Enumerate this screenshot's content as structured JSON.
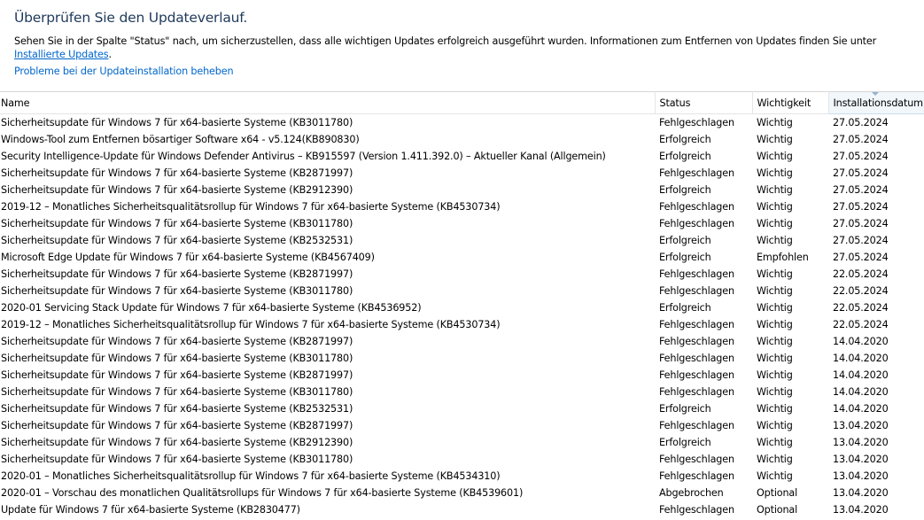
{
  "header": {
    "title": "Überprüfen Sie den Updateverlauf.",
    "description_text": "Sehen Sie in der Spalte \"Status\" nach, um sicherzustellen, dass alle wichtigen Updates erfolgreich ausgeführt wurden. Informationen zum Entfernen von Updates finden Sie unter ",
    "description_link": "Installierte Updates",
    "description_end": ".",
    "troubleshoot_link": "Probleme bei der Updateinstallation beheben"
  },
  "columns": {
    "name": "Name",
    "status": "Status",
    "importance": "Wichtigkeit",
    "date": "Installationsdatum"
  },
  "rows": [
    [
      "Sicherheitsupdate für Windows 7 für x64-basierte Systeme (KB3011780)",
      "Fehlgeschlagen",
      "Wichtig",
      "27.05.2024"
    ],
    [
      "Windows-Tool zum Entfernen bösartiger Software x64 - v5.124(KB890830)",
      "Erfolgreich",
      "Wichtig",
      "27.05.2024"
    ],
    [
      "Security Intelligence-Update für Windows Defender Antivirus – KB915597 (Version 1.411.392.0) – Aktueller Kanal (Allgemein)",
      "Erfolgreich",
      "Wichtig",
      "27.05.2024"
    ],
    [
      "Sicherheitsupdate für Windows 7 für x64-basierte Systeme (KB2871997)",
      "Fehlgeschlagen",
      "Wichtig",
      "27.05.2024"
    ],
    [
      "Sicherheitsupdate für Windows 7 für x64-basierte Systeme (KB2912390)",
      "Erfolgreich",
      "Wichtig",
      "27.05.2024"
    ],
    [
      "2019-12 – Monatliches Sicherheitsqualitätsrollup für Windows 7 für x64-basierte Systeme (KB4530734)",
      "Fehlgeschlagen",
      "Wichtig",
      "27.05.2024"
    ],
    [
      "Sicherheitsupdate für Windows 7 für x64-basierte Systeme (KB3011780)",
      "Fehlgeschlagen",
      "Wichtig",
      "27.05.2024"
    ],
    [
      "Sicherheitsupdate für Windows 7 für x64-basierte Systeme (KB2532531)",
      "Erfolgreich",
      "Wichtig",
      "27.05.2024"
    ],
    [
      "Microsoft Edge Update für Windows 7 für x64-basierte Systeme (KB4567409)",
      "Erfolgreich",
      "Empfohlen",
      "27.05.2024"
    ],
    [
      "Sicherheitsupdate für Windows 7 für x64-basierte Systeme (KB2871997)",
      "Fehlgeschlagen",
      "Wichtig",
      "22.05.2024"
    ],
    [
      "Sicherheitsupdate für Windows 7 für x64-basierte Systeme (KB3011780)",
      "Fehlgeschlagen",
      "Wichtig",
      "22.05.2024"
    ],
    [
      "2020-01 Servicing Stack Update für Windows 7 für x64-basierte Systeme (KB4536952)",
      "Erfolgreich",
      "Wichtig",
      "22.05.2024"
    ],
    [
      "2019-12 – Monatliches Sicherheitsqualitätsrollup für Windows 7 für x64-basierte Systeme (KB4530734)",
      "Fehlgeschlagen",
      "Wichtig",
      "22.05.2024"
    ],
    [
      "Sicherheitsupdate für Windows 7 für x64-basierte Systeme (KB2871997)",
      "Fehlgeschlagen",
      "Wichtig",
      "14.04.2020"
    ],
    [
      "Sicherheitsupdate für Windows 7 für x64-basierte Systeme (KB3011780)",
      "Fehlgeschlagen",
      "Wichtig",
      "14.04.2020"
    ],
    [
      "Sicherheitsupdate für Windows 7 für x64-basierte Systeme (KB2871997)",
      "Fehlgeschlagen",
      "Wichtig",
      "14.04.2020"
    ],
    [
      "Sicherheitsupdate für Windows 7 für x64-basierte Systeme (KB3011780)",
      "Fehlgeschlagen",
      "Wichtig",
      "14.04.2020"
    ],
    [
      "Sicherheitsupdate für Windows 7 für x64-basierte Systeme (KB2532531)",
      "Erfolgreich",
      "Wichtig",
      "14.04.2020"
    ],
    [
      "Sicherheitsupdate für Windows 7 für x64-basierte Systeme (KB2871997)",
      "Fehlgeschlagen",
      "Wichtig",
      "13.04.2020"
    ],
    [
      "Sicherheitsupdate für Windows 7 für x64-basierte Systeme (KB2912390)",
      "Erfolgreich",
      "Wichtig",
      "13.04.2020"
    ],
    [
      "Sicherheitsupdate für Windows 7 für x64-basierte Systeme (KB3011780)",
      "Fehlgeschlagen",
      "Wichtig",
      "13.04.2020"
    ],
    [
      "2020-01 – Monatliches Sicherheitsqualitätsrollup für Windows 7 für x64-basierte Systeme (KB4534310)",
      "Fehlgeschlagen",
      "Wichtig",
      "13.04.2020"
    ],
    [
      "2020-01 – Vorschau des monatlichen Qualitätsrollups für Windows 7 für x64-basierte Systeme (KB4539601)",
      "Abgebrochen",
      "Optional",
      "13.04.2020"
    ],
    [
      "Update für Windows 7 für x64-basierte Systeme (KB2830477)",
      "Fehlgeschlagen",
      "Optional",
      "13.04.2020"
    ]
  ],
  "colors": {
    "title": "#1e395b",
    "link": "#0066cc",
    "sorted_header": "#f2f7fc"
  }
}
